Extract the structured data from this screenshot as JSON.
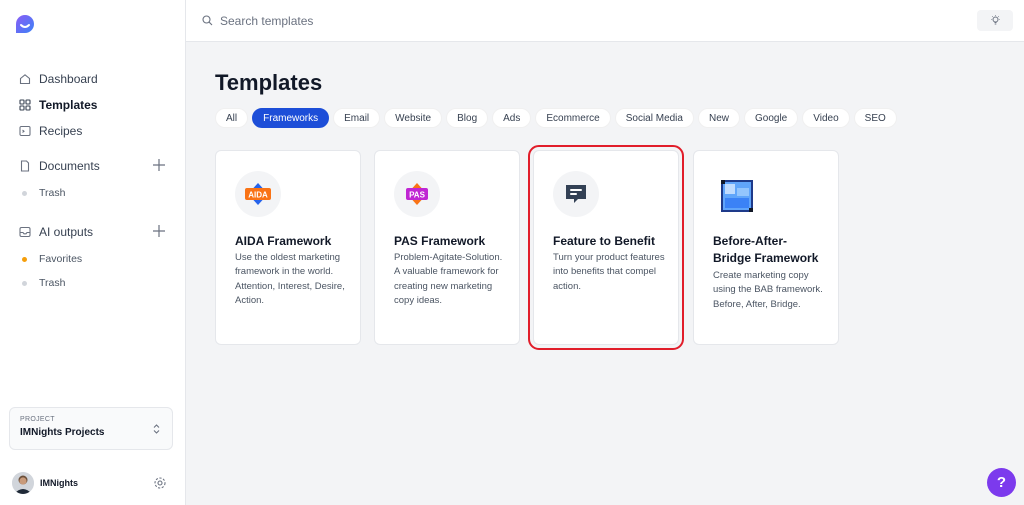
{
  "sidebar": {
    "nav": [
      {
        "label": "Dashboard",
        "icon": "home-icon"
      },
      {
        "label": "Templates",
        "icon": "grid-icon",
        "active": true
      },
      {
        "label": "Recipes",
        "icon": "terminal-icon"
      }
    ],
    "documents": {
      "label": "Documents",
      "items": [
        "Trash"
      ]
    },
    "ai_outputs": {
      "label": "AI outputs",
      "items": [
        "Favorites",
        "Trash"
      ]
    },
    "project": {
      "label": "PROJECT",
      "value": "IMNights Projects"
    },
    "user": {
      "name": "IMNights"
    }
  },
  "search": {
    "placeholder": "Search templates"
  },
  "page": {
    "title": "Templates"
  },
  "tabs": [
    "All",
    "Frameworks",
    "Email",
    "Website",
    "Blog",
    "Ads",
    "Ecommerce",
    "Social Media",
    "New",
    "Google",
    "Video",
    "SEO"
  ],
  "active_tab": "Frameworks",
  "cards": [
    {
      "badge": "AIDA",
      "title": "AIDA Framework",
      "description": "Use the oldest marketing framework in the world. Attention, Interest, Desire, Action."
    },
    {
      "badge": "PAS",
      "title": "PAS Framework",
      "description": "Problem-Agitate-Solution. A valuable framework for creating new marketing copy ideas."
    },
    {
      "title": "Feature to Benefit",
      "description": "Turn your product features into benefits that compel action."
    },
    {
      "title": "Before-After-Bridge Framework",
      "description": "Create marketing copy using the BAB framework. Before, After, Bridge."
    }
  ],
  "help": {
    "label": "?"
  },
  "colors": {
    "accent": "#1d4ed8",
    "highlight": "#e11d2a",
    "help": "#7c3aed"
  }
}
